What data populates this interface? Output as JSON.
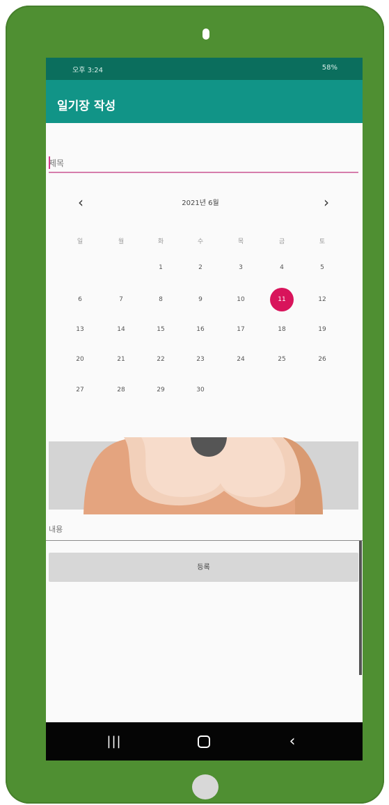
{
  "status_bar": {
    "left": "오후 3:24",
    "right": "58%"
  },
  "app_bar": {
    "title": "일기장 작성"
  },
  "title_field": {
    "placeholder": "제목",
    "value": ""
  },
  "calendar": {
    "month_label": "2021년 6월",
    "weekdays": [
      "일",
      "월",
      "화",
      "수",
      "목",
      "금",
      "토"
    ],
    "days": [
      [
        "",
        "",
        "1",
        "2",
        "3",
        "4",
        "5"
      ],
      [
        "6",
        "7",
        "8",
        "9",
        "10",
        "11",
        "12"
      ],
      [
        "13",
        "14",
        "15",
        "16",
        "17",
        "18",
        "19"
      ],
      [
        "20",
        "21",
        "22",
        "23",
        "24",
        "25",
        "26"
      ],
      [
        "27",
        "28",
        "29",
        "30",
        "",
        "",
        ""
      ]
    ],
    "selected_day": "11",
    "accent_color": "#d8145b"
  },
  "content_field": {
    "placeholder": "내용",
    "value": ""
  },
  "register_button": {
    "label": "등록"
  },
  "system_navigation": {
    "recent_icon": "recent-apps-icon",
    "home_icon": "home-icon",
    "back_icon": "back-icon"
  },
  "colors": {
    "device_frame": "#4f8f32",
    "status_bar": "#0b6e5d",
    "app_bar": "#119487",
    "selected_day": "#d8145b"
  }
}
